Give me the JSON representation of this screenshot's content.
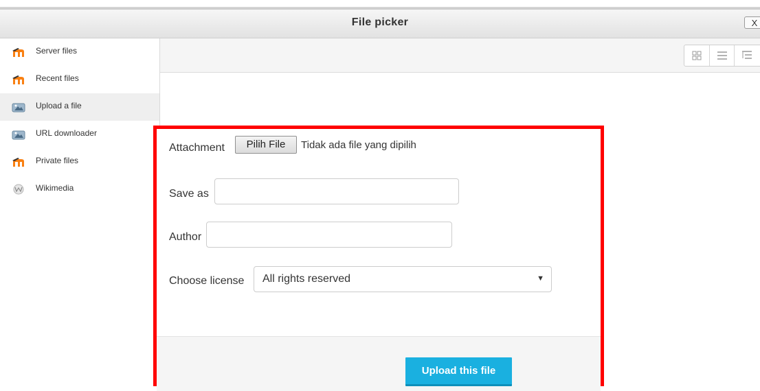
{
  "dialog": {
    "title": "File picker",
    "close_label": "X"
  },
  "sidebar": {
    "items": [
      {
        "label": "Server files",
        "icon": "moodle-icon"
      },
      {
        "label": "Recent files",
        "icon": "moodle-icon"
      },
      {
        "label": "Upload a file",
        "icon": "upload-icon",
        "active": true
      },
      {
        "label": "URL downloader",
        "icon": "url-download-icon"
      },
      {
        "label": "Private files",
        "icon": "moodle-icon"
      },
      {
        "label": "Wikimedia",
        "icon": "wikimedia-icon"
      }
    ]
  },
  "toolbar": {
    "views": [
      "icon-view-icon",
      "list-view-icon",
      "tree-view-icon"
    ]
  },
  "form": {
    "attachment_label": "Attachment",
    "choose_file_button": "Pilih File",
    "file_status": "Tidak ada file yang dipilih",
    "saveas_label": "Save as",
    "saveas_value": "",
    "author_label": "Author",
    "author_value": "",
    "license_label": "Choose license",
    "license_value": "All rights reserved",
    "upload_button": "Upload this file"
  },
  "colors": {
    "accent": "#1ab0e0",
    "highlight_border": "#ff0000",
    "moodle_orange": "#f98012"
  }
}
